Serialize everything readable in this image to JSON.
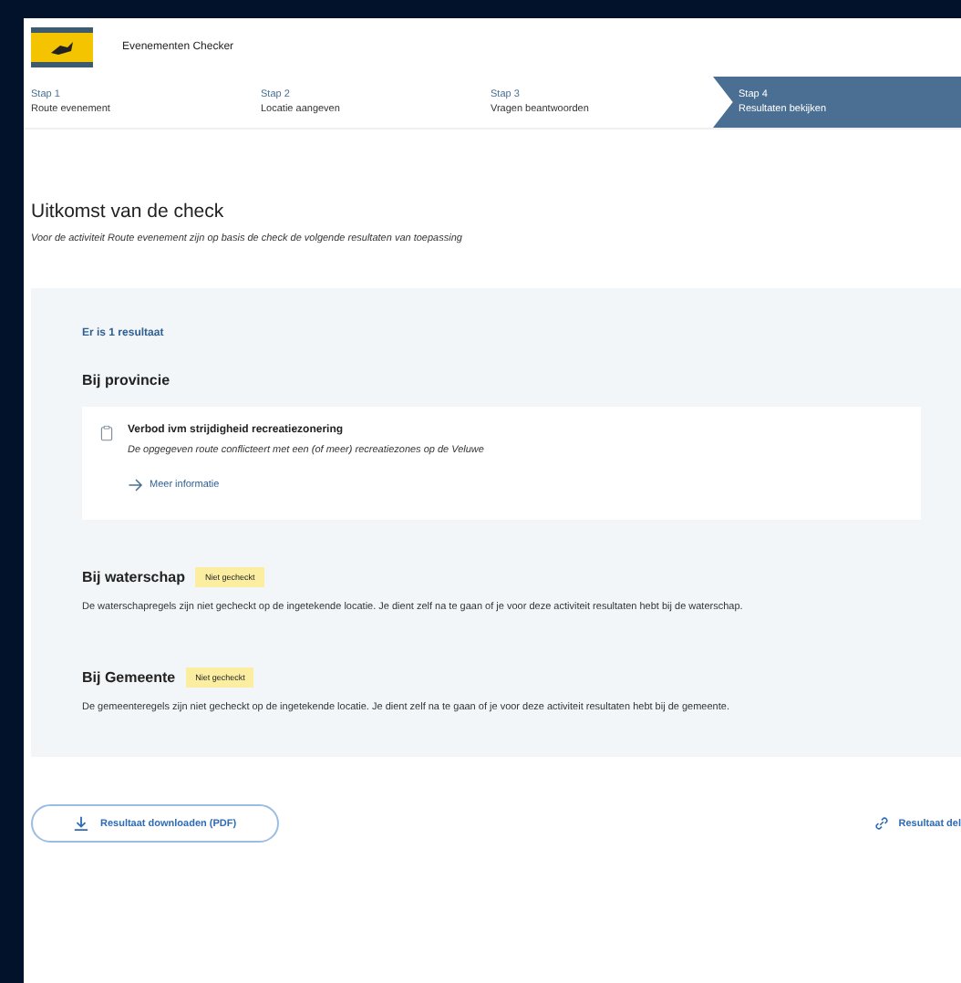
{
  "header": {
    "title": "Evenementen Checker"
  },
  "steps": [
    {
      "label": "Stap 1",
      "name": "Route evenement",
      "selected": false
    },
    {
      "label": "Stap 2",
      "name": "Locatie aangeven",
      "selected": false
    },
    {
      "label": "Stap 3",
      "name": "Vragen beantwoorden",
      "selected": false
    },
    {
      "label": "Stap 4",
      "name": "Resultaten bekijken",
      "selected": true
    }
  ],
  "heading": "Uitkomst van de check",
  "intro": "Voor de activiteit Route evenement zijn op basis de check de volgende resultaten van toepassing",
  "result_count": "Er is 1 resultaat",
  "sections": [
    {
      "title": "Bij provincie",
      "result": {
        "title": "Verbod ivm strijdigheid recreatiezonering",
        "text": "De opgegeven route conflicteert met een (of meer) recreatiezones op de Veluwe",
        "link": "Meer informatie"
      }
    },
    {
      "title": "Bij waterschap",
      "badge": "Niet gecheckt",
      "text": "De waterschapregels zijn niet gecheckt op de ingetekende locatie. Je dient zelf na te gaan of je voor deze activiteit resultaten hebt bij de waterschap."
    },
    {
      "title": "Bij Gemeente",
      "badge": "Niet gecheckt",
      "text": "De gemeenteregels zijn niet gecheckt op de ingetekende locatie. Je dient zelf na te gaan of je voor deze activiteit resultaten hebt bij de gemeente."
    }
  ],
  "actions": [
    {
      "kind": "download",
      "label": "Resultaat downloaden (PDF)"
    },
    {
      "kind": "share",
      "label": "Resultaat del"
    }
  ]
}
